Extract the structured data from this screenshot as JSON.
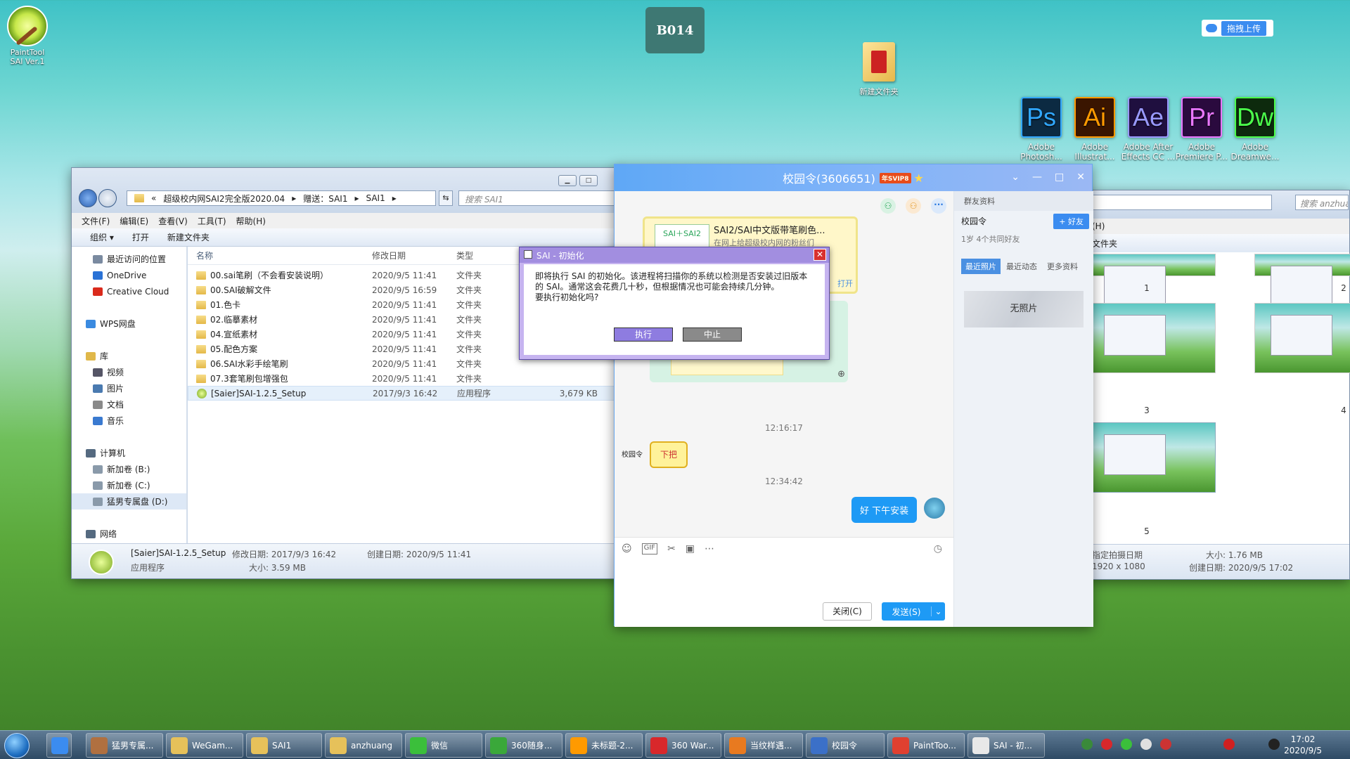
{
  "desktop": {
    "badge": "B014",
    "paint_tool_label": "PaintTool\nSAI Ver.1",
    "new_folder_label": "新建文件夹",
    "cloud_upload": "拖拽上传",
    "adobe": [
      {
        "abbr": "Ps",
        "label": "Adobe\nPhotosh...",
        "bg": "#0c2a42",
        "fg": "#31a8ff"
      },
      {
        "abbr": "Ai",
        "label": "Adobe\nIllustrat...",
        "bg": "#3a1500",
        "fg": "#ff9a00"
      },
      {
        "abbr": "Ae",
        "label": "Adobe After\nEffects CC ...",
        "bg": "#1f0f3f",
        "fg": "#9999ff"
      },
      {
        "abbr": "Pr",
        "label": "Adobe\nPremiere P...",
        "bg": "#2a0a3e",
        "fg": "#ea77ff"
      },
      {
        "abbr": "Dw",
        "label": "Adobe\nDreamwe...",
        "bg": "#0d2a0d",
        "fg": "#4cff4c"
      }
    ]
  },
  "explorer": {
    "address": [
      "«",
      "超级校内网SAI2完全版2020.04",
      "▸",
      "赠送：SAI1",
      "▸",
      "SAI1",
      "▸"
    ],
    "search_placeholder": "搜索 SAI1",
    "menu": [
      "文件(F)",
      "编辑(E)",
      "查看(V)",
      "工具(T)",
      "帮助(H)"
    ],
    "toolbar": [
      "组织 ▾",
      "打开",
      "新建文件夹"
    ],
    "nav": [
      {
        "label": "最近访问的位置",
        "color": "#7a8aa0"
      },
      {
        "label": "OneDrive",
        "color": "#2a72d6"
      },
      {
        "label": "Creative Cloud",
        "color": "#da2a1c"
      },
      {
        "label": "",
        "color": ""
      },
      {
        "label": "WPS网盘",
        "color": "#3a8ae0"
      },
      {
        "label": "",
        "color": ""
      },
      {
        "label": "库",
        "color": "#e0b84a"
      },
      {
        "label": "视频",
        "color": "#556"
      },
      {
        "label": "图片",
        "color": "#4a7ab0"
      },
      {
        "label": "文档",
        "color": "#8a8a8a"
      },
      {
        "label": "音乐",
        "color": "#3a7ad0"
      },
      {
        "label": "",
        "color": ""
      },
      {
        "label": "计算机",
        "color": "#556a80"
      },
      {
        "label": "新加卷 (B:)",
        "color": "#8a9aaa"
      },
      {
        "label": "新加卷 (C:)",
        "color": "#8a9aaa"
      },
      {
        "label": "猛男专属盘 (D:)",
        "color": "#8a9aaa"
      },
      {
        "label": "",
        "color": ""
      },
      {
        "label": "网络",
        "color": "#556a80"
      }
    ],
    "columns": {
      "name": "名称",
      "date": "修改日期",
      "type": "类型"
    },
    "files": [
      {
        "name": "00.sai笔刷（不会看安装说明）",
        "date": "2020/9/5 11:41",
        "type": "文件夹",
        "size": "",
        "kind": "folder"
      },
      {
        "name": "00.SAI破解文件",
        "date": "2020/9/5 16:59",
        "type": "文件夹",
        "size": "",
        "kind": "folder"
      },
      {
        "name": "01.色卡",
        "date": "2020/9/5 11:41",
        "type": "文件夹",
        "size": "",
        "kind": "folder"
      },
      {
        "name": "02.临摹素材",
        "date": "2020/9/5 11:41",
        "type": "文件夹",
        "size": "",
        "kind": "folder"
      },
      {
        "name": "04.宣纸素材",
        "date": "2020/9/5 11:41",
        "type": "文件夹",
        "size": "",
        "kind": "folder"
      },
      {
        "name": "05.配色方案",
        "date": "2020/9/5 11:41",
        "type": "文件夹",
        "size": "",
        "kind": "folder"
      },
      {
        "name": "06.SAI水彩手绘笔刷",
        "date": "2020/9/5 11:41",
        "type": "文件夹",
        "size": "",
        "kind": "folder"
      },
      {
        "name": "07.3套笔刷包增强包",
        "date": "2020/9/5 11:41",
        "type": "文件夹",
        "size": "",
        "kind": "folder"
      },
      {
        "name": "[Saier]SAI-1.2.5_Setup",
        "date": "2017/9/3 16:42",
        "type": "应用程序",
        "size": "3,679 KB",
        "kind": "app"
      }
    ],
    "details": {
      "name": "[Saier]SAI-1.2.5_Setup",
      "type": "应用程序",
      "modified": "修改日期: 2017/9/3 16:42",
      "size": "大小: 3.59 MB",
      "created": "创建日期: 2020/9/5 11:41"
    }
  },
  "chat": {
    "title": "校园令(3606651)",
    "vip": "年SVIP8",
    "card_title": "SAI2/SAI中文版带笔刷色...",
    "card_desc": "在网上给超级校内网的粉丝们",
    "card_logo": "SAI＋SAI2",
    "card_open": "打开",
    "time1": "12:16:17",
    "sticker_sender": "校园令",
    "sticker_text": "下把",
    "time2": "12:34:42",
    "my_msg": "好 下午安装",
    "close_btn": "关闭(C)",
    "send_btn": "发送(S)",
    "side": {
      "header": "群友资料",
      "name": "校园令",
      "add_friend": "+ 好友",
      "info": "1岁 4个共同好友",
      "tabs": [
        "最近照片",
        "最近动态",
        "更多资料"
      ],
      "no_photo": "无照片"
    }
  },
  "dialog": {
    "title": "SAI - 初始化",
    "line1": "即将执行 SAI 的初始化。该进程将扫描你的系统以检测是否安装过旧版本",
    "line2": "的 SAI。通常这会花费几十秒，但根据情况也可能会持续几分钟。",
    "line3": "要执行初始化吗?",
    "ok": "执行",
    "cancel": "中止"
  },
  "right_explorer": {
    "search": "搜索 anzhua",
    "menu_help": "(H)",
    "new_folder": "文件夹",
    "thumb_labels": [
      "1",
      "2",
      "3",
      "4",
      "5"
    ],
    "detail": {
      "shot_date": "指定拍摄日期",
      "dims": "1920 x 1080",
      "size": "大小: 1.76 MB",
      "created": "创建日期: 2020/9/5 17:02"
    }
  },
  "taskbar": {
    "items": [
      {
        "label": "",
        "color": "#3b8cf0"
      },
      {
        "label": "猛男专属...",
        "color": "#b07040"
      },
      {
        "label": "WeGam...",
        "color": "#e6c15a"
      },
      {
        "label": "SAI1",
        "color": "#e6c15a"
      },
      {
        "label": "anzhuang",
        "color": "#e6c15a"
      },
      {
        "label": "微信",
        "color": "#3bbf3b"
      },
      {
        "label": "360随身...",
        "color": "#3aa83a"
      },
      {
        "label": "未标题-2...",
        "color": "#ff9a00"
      },
      {
        "label": "360 War...",
        "color": "#d8282b"
      },
      {
        "label": "当纹样遇...",
        "color": "#e87a20"
      },
      {
        "label": "校园令",
        "color": "#3b70c8"
      },
      {
        "label": "PaintToo...",
        "color": "#e04030"
      },
      {
        "label": "SAI - 初...",
        "color": "#e8e8e8"
      }
    ],
    "time": "17:02",
    "date": "2020/9/5"
  }
}
